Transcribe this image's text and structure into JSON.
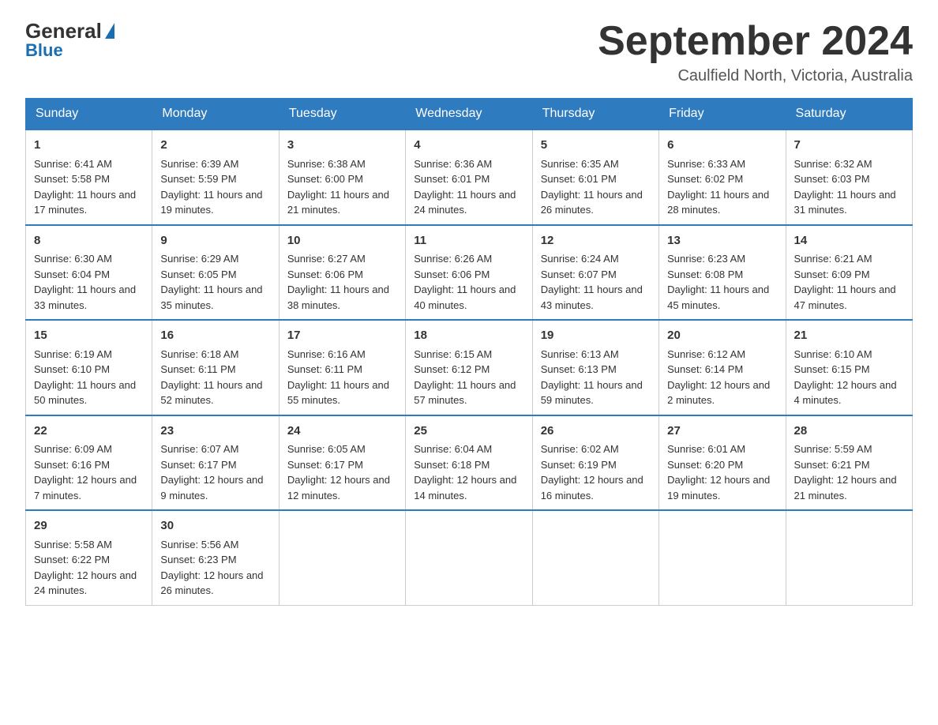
{
  "header": {
    "logo": {
      "general": "General",
      "blue": "Blue",
      "tagline": "Blue"
    },
    "title": "September 2024",
    "location": "Caulfield North, Victoria, Australia"
  },
  "days_of_week": [
    "Sunday",
    "Monday",
    "Tuesday",
    "Wednesday",
    "Thursday",
    "Friday",
    "Saturday"
  ],
  "weeks": [
    [
      {
        "day": "1",
        "sunrise": "Sunrise: 6:41 AM",
        "sunset": "Sunset: 5:58 PM",
        "daylight": "Daylight: 11 hours and 17 minutes."
      },
      {
        "day": "2",
        "sunrise": "Sunrise: 6:39 AM",
        "sunset": "Sunset: 5:59 PM",
        "daylight": "Daylight: 11 hours and 19 minutes."
      },
      {
        "day": "3",
        "sunrise": "Sunrise: 6:38 AM",
        "sunset": "Sunset: 6:00 PM",
        "daylight": "Daylight: 11 hours and 21 minutes."
      },
      {
        "day": "4",
        "sunrise": "Sunrise: 6:36 AM",
        "sunset": "Sunset: 6:01 PM",
        "daylight": "Daylight: 11 hours and 24 minutes."
      },
      {
        "day": "5",
        "sunrise": "Sunrise: 6:35 AM",
        "sunset": "Sunset: 6:01 PM",
        "daylight": "Daylight: 11 hours and 26 minutes."
      },
      {
        "day": "6",
        "sunrise": "Sunrise: 6:33 AM",
        "sunset": "Sunset: 6:02 PM",
        "daylight": "Daylight: 11 hours and 28 minutes."
      },
      {
        "day": "7",
        "sunrise": "Sunrise: 6:32 AM",
        "sunset": "Sunset: 6:03 PM",
        "daylight": "Daylight: 11 hours and 31 minutes."
      }
    ],
    [
      {
        "day": "8",
        "sunrise": "Sunrise: 6:30 AM",
        "sunset": "Sunset: 6:04 PM",
        "daylight": "Daylight: 11 hours and 33 minutes."
      },
      {
        "day": "9",
        "sunrise": "Sunrise: 6:29 AM",
        "sunset": "Sunset: 6:05 PM",
        "daylight": "Daylight: 11 hours and 35 minutes."
      },
      {
        "day": "10",
        "sunrise": "Sunrise: 6:27 AM",
        "sunset": "Sunset: 6:06 PM",
        "daylight": "Daylight: 11 hours and 38 minutes."
      },
      {
        "day": "11",
        "sunrise": "Sunrise: 6:26 AM",
        "sunset": "Sunset: 6:06 PM",
        "daylight": "Daylight: 11 hours and 40 minutes."
      },
      {
        "day": "12",
        "sunrise": "Sunrise: 6:24 AM",
        "sunset": "Sunset: 6:07 PM",
        "daylight": "Daylight: 11 hours and 43 minutes."
      },
      {
        "day": "13",
        "sunrise": "Sunrise: 6:23 AM",
        "sunset": "Sunset: 6:08 PM",
        "daylight": "Daylight: 11 hours and 45 minutes."
      },
      {
        "day": "14",
        "sunrise": "Sunrise: 6:21 AM",
        "sunset": "Sunset: 6:09 PM",
        "daylight": "Daylight: 11 hours and 47 minutes."
      }
    ],
    [
      {
        "day": "15",
        "sunrise": "Sunrise: 6:19 AM",
        "sunset": "Sunset: 6:10 PM",
        "daylight": "Daylight: 11 hours and 50 minutes."
      },
      {
        "day": "16",
        "sunrise": "Sunrise: 6:18 AM",
        "sunset": "Sunset: 6:11 PM",
        "daylight": "Daylight: 11 hours and 52 minutes."
      },
      {
        "day": "17",
        "sunrise": "Sunrise: 6:16 AM",
        "sunset": "Sunset: 6:11 PM",
        "daylight": "Daylight: 11 hours and 55 minutes."
      },
      {
        "day": "18",
        "sunrise": "Sunrise: 6:15 AM",
        "sunset": "Sunset: 6:12 PM",
        "daylight": "Daylight: 11 hours and 57 minutes."
      },
      {
        "day": "19",
        "sunrise": "Sunrise: 6:13 AM",
        "sunset": "Sunset: 6:13 PM",
        "daylight": "Daylight: 11 hours and 59 minutes."
      },
      {
        "day": "20",
        "sunrise": "Sunrise: 6:12 AM",
        "sunset": "Sunset: 6:14 PM",
        "daylight": "Daylight: 12 hours and 2 minutes."
      },
      {
        "day": "21",
        "sunrise": "Sunrise: 6:10 AM",
        "sunset": "Sunset: 6:15 PM",
        "daylight": "Daylight: 12 hours and 4 minutes."
      }
    ],
    [
      {
        "day": "22",
        "sunrise": "Sunrise: 6:09 AM",
        "sunset": "Sunset: 6:16 PM",
        "daylight": "Daylight: 12 hours and 7 minutes."
      },
      {
        "day": "23",
        "sunrise": "Sunrise: 6:07 AM",
        "sunset": "Sunset: 6:17 PM",
        "daylight": "Daylight: 12 hours and 9 minutes."
      },
      {
        "day": "24",
        "sunrise": "Sunrise: 6:05 AM",
        "sunset": "Sunset: 6:17 PM",
        "daylight": "Daylight: 12 hours and 12 minutes."
      },
      {
        "day": "25",
        "sunrise": "Sunrise: 6:04 AM",
        "sunset": "Sunset: 6:18 PM",
        "daylight": "Daylight: 12 hours and 14 minutes."
      },
      {
        "day": "26",
        "sunrise": "Sunrise: 6:02 AM",
        "sunset": "Sunset: 6:19 PM",
        "daylight": "Daylight: 12 hours and 16 minutes."
      },
      {
        "day": "27",
        "sunrise": "Sunrise: 6:01 AM",
        "sunset": "Sunset: 6:20 PM",
        "daylight": "Daylight: 12 hours and 19 minutes."
      },
      {
        "day": "28",
        "sunrise": "Sunrise: 5:59 AM",
        "sunset": "Sunset: 6:21 PM",
        "daylight": "Daylight: 12 hours and 21 minutes."
      }
    ],
    [
      {
        "day": "29",
        "sunrise": "Sunrise: 5:58 AM",
        "sunset": "Sunset: 6:22 PM",
        "daylight": "Daylight: 12 hours and 24 minutes."
      },
      {
        "day": "30",
        "sunrise": "Sunrise: 5:56 AM",
        "sunset": "Sunset: 6:23 PM",
        "daylight": "Daylight: 12 hours and 26 minutes."
      },
      null,
      null,
      null,
      null,
      null
    ]
  ]
}
